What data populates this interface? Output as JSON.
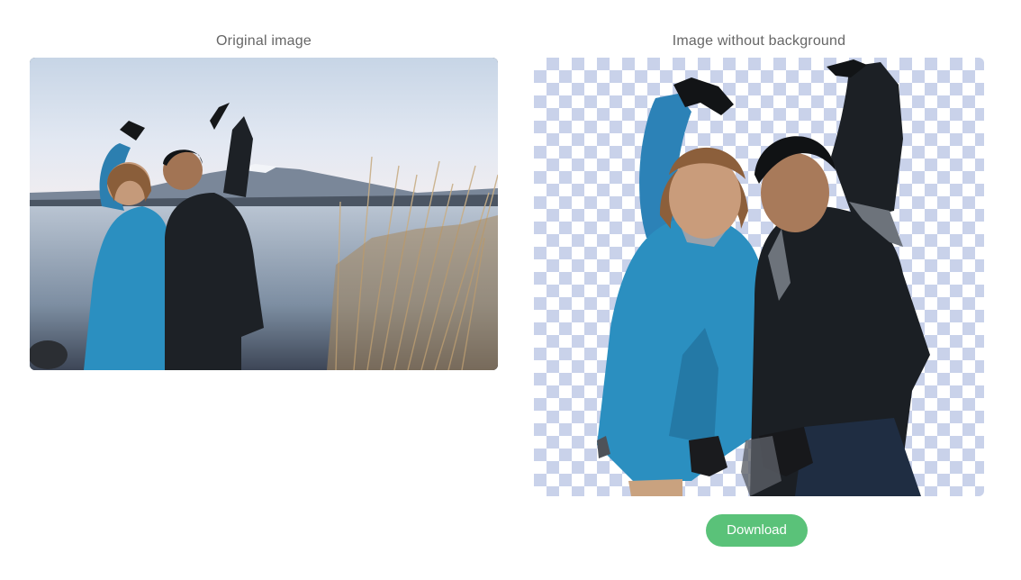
{
  "panels": {
    "original": {
      "title": "Original image"
    },
    "result": {
      "title": "Image without background"
    }
  },
  "actions": {
    "download_label": "Download"
  },
  "colors": {
    "download_button": "#5ac279",
    "title_text": "#666666",
    "checker": "#c9d2ea"
  }
}
